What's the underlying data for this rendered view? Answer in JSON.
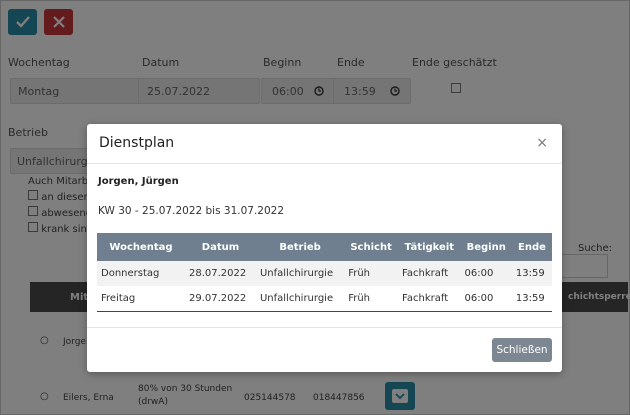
{
  "toolbar": {
    "confirm_icon": "check-icon",
    "cancel_icon": "close-icon"
  },
  "form": {
    "wochentag_label": "Wochentag",
    "datum_label": "Datum",
    "beginn_label": "Beginn",
    "ende_label": "Ende",
    "ende_geschaetzt_label": "Ende geschätzt",
    "wochentag_value": "Montag",
    "datum_value": "25.07.2022",
    "beginn_value": "06:00",
    "ende_value": "13:59",
    "betrieb_label": "Betrieb",
    "betrieb_value": "Unfallchirurgie",
    "auch_label": "Auch Mitarbe",
    "option1": "an diesem",
    "option2": "abwesend",
    "option3": "krank sind.",
    "suche_label": "Suche:"
  },
  "background_table": {
    "col_partial_left": "Mit",
    "col_partial_right": "chichtsperren",
    "row1_name": "Jorge",
    "row2_name": "Eilers, Erna",
    "row2_hours": "80% von 30 Stunden",
    "row2_hours2": "(drwA)",
    "row2_num1": "025144578",
    "row2_num2": "018447856"
  },
  "modal": {
    "title": "Dienstplan",
    "close_symbol": "×",
    "employee_name": "Jorgen, Jürgen",
    "week_info": "KW 30 - 25.07.2022 bis 31.07.2022",
    "columns": [
      "Wochentag",
      "Datum",
      "Betrieb",
      "Schicht",
      "Tätigkeit",
      "Beginn",
      "Ende"
    ],
    "rows": [
      [
        "Donnerstag",
        "28.07.2022",
        "Unfallchirurgie",
        "Früh",
        "Fachkraft",
        "06:00",
        "13:59"
      ],
      [
        "Freitag",
        "29.07.2022",
        "Unfallchirurgie",
        "Früh",
        "Fachkraft",
        "06:00",
        "13:59"
      ]
    ],
    "close_button": "Schließen"
  },
  "colors": {
    "primary": "#2b8da6",
    "danger": "#c9363c",
    "table_header": "#6f7f8f",
    "close_button": "#7d8791"
  }
}
